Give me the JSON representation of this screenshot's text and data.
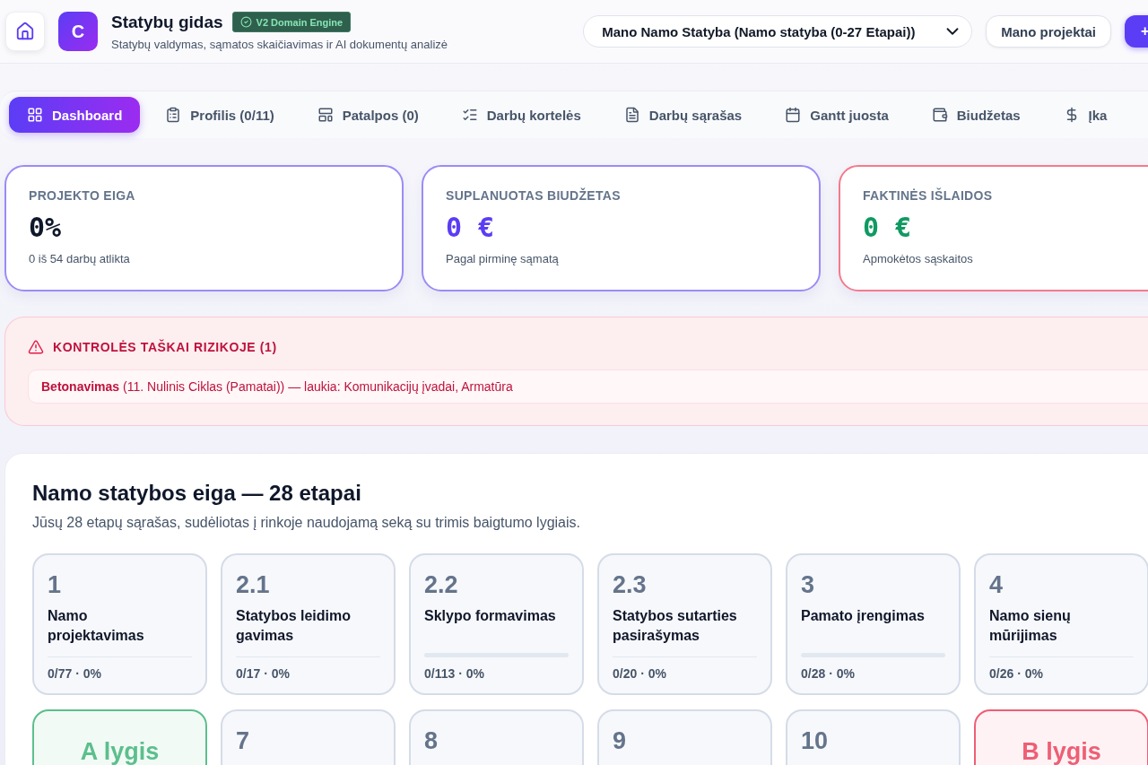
{
  "header": {
    "logo_letter": "C",
    "title": "Statybų gidas",
    "badge": "V2 Domain Engine",
    "subtitle": "Statybų valdymas, sąmatos skaičiavimas ir AI dokumentų analizė",
    "project_select": "Mano Namo Statyba (Namo statyba (0-27 Etapai))",
    "projects_button": "Mano projektai",
    "add_button": "+"
  },
  "tabs": [
    {
      "label": "Dashboard",
      "selected": true
    },
    {
      "label": "Profilis (0/11)",
      "selected": false
    },
    {
      "label": "Patalpos (0)",
      "selected": false
    },
    {
      "label": "Darbų kortelės",
      "selected": false
    },
    {
      "label": "Darbų sąrašas",
      "selected": false
    },
    {
      "label": "Gantt juosta",
      "selected": false
    },
    {
      "label": "Biudžetas",
      "selected": false
    },
    {
      "label": "Įka",
      "selected": false
    }
  ],
  "stats": [
    {
      "label": "PROJEKTO EIGA",
      "value": "0%",
      "note": "0 iš 54 darbų atlikta",
      "color": "#9b8cf5",
      "kind": "progress"
    },
    {
      "label": "SUPLANUOTAS BIUDŽETAS",
      "value": "0 €",
      "note": "Pagal pirminę sąmatą",
      "color": "#9b8cf5",
      "kind": "budget"
    },
    {
      "label": "FAKTINĖS IŠLAIDOS",
      "value": "0 €",
      "note": "Apmokėtos sąskaitos",
      "color": "#f47a8c",
      "kind": "expense"
    }
  ],
  "alert": {
    "title": "KONTROLĖS TAŠKAI RIZIKOJE (1)",
    "items": [
      "**Betonavimas** (11. Nulinis Ciklas (Pamatai)) — laukia: Komunikacijų įvadai, Armatūra"
    ]
  },
  "progress": {
    "title": "Namo statybos eiga — 28 etapai",
    "subtitle": "Jūsų 28 etapų sąrašas, sudėliotas į rinkoje naudojamą seką su trimis baigtumo lygiais.",
    "stages": [
      {
        "kind": "stage",
        "number": "1",
        "title": "Namo projektavimas",
        "level": 0,
        "reading": "0/77 · 0%"
      },
      {
        "kind": "stage",
        "number": "2.1",
        "title": "Statybos leidimo gavimas",
        "level": 0,
        "reading": "0/17 · 0%"
      },
      {
        "kind": "stage",
        "number": "2.2",
        "title": "Sklypo formavimas",
        "level": 0,
        "reading": "0/113 · 0%"
      },
      {
        "kind": "stage",
        "number": "2.3",
        "title": "Statybos sutarties pasirašymas",
        "level": 0,
        "reading": "0/20 · 0%"
      },
      {
        "kind": "stage",
        "number": "3",
        "title": "Pamato įrengimas",
        "level": 0,
        "reading": "0/28 · 0%"
      },
      {
        "kind": "stage",
        "number": "4",
        "title": "Namo sienų mūrijimas",
        "level": 0,
        "reading": "0/26 · 0%"
      },
      {
        "kind": "level",
        "label": "A lygis",
        "color": "#5cbf8c"
      },
      {
        "kind": "stage",
        "number": "7"
      },
      {
        "kind": "stage",
        "number": "8"
      },
      {
        "kind": "stage",
        "number": "9"
      },
      {
        "kind": "stage",
        "number": "10"
      },
      {
        "kind": "level",
        "label": "B lygis",
        "color": "#ee5f75"
      }
    ]
  }
}
